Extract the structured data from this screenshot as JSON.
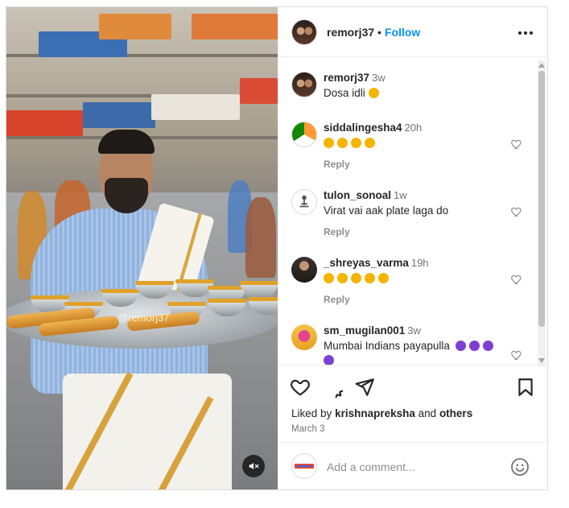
{
  "media": {
    "watermark": "@remorj37",
    "mute_icon": "speaker-muted-icon"
  },
  "header": {
    "username": "remorj37",
    "separator": "•",
    "follow_label": "Follow",
    "more_icon": "more-horizontal-icon"
  },
  "comments": [
    {
      "username": "remorj37",
      "time": "3w",
      "text": "Dosa idli",
      "emoji": [
        "#f5b400"
      ],
      "reply": ""
    },
    {
      "username": "siddalingesha4",
      "time": "20h",
      "text": "",
      "emoji": [
        "#f5b400",
        "#f5b400",
        "#f5b400",
        "#f5b400"
      ],
      "reply": "Reply"
    },
    {
      "username": "tulon_sonoal",
      "time": "1w",
      "text": "Virat vai aak plate laga do",
      "emoji": [],
      "reply": "Reply"
    },
    {
      "username": "_shreyas_varma",
      "time": "19h",
      "text": "",
      "emoji": [
        "#f5b400",
        "#f5b400",
        "#f5b400",
        "#f5b400",
        "#f5b400"
      ],
      "reply": "Reply"
    },
    {
      "username": "sm_mugilan001",
      "time": "3w",
      "text": "Mumbai Indians payapulla",
      "emoji": [
        "#7e3fd0",
        "#7e3fd0",
        "#7e3fd0",
        "#7e3fd0"
      ],
      "reply": ""
    }
  ],
  "actions": {
    "like_icon": "heart-icon",
    "comment_icon": "comment-icon",
    "share_icon": "share-icon",
    "save_icon": "bookmark-icon",
    "liked_by_prefix": "Liked by",
    "liked_by_user": "krishnapreksha",
    "liked_by_and": "and",
    "liked_by_others": "others",
    "date": "March 3"
  },
  "add_comment": {
    "placeholder": "Add a comment...",
    "emoji_icon": "smiley-icon"
  },
  "colors": {
    "accent": "#0095f6",
    "text": "#262626",
    "muted": "#737373"
  }
}
